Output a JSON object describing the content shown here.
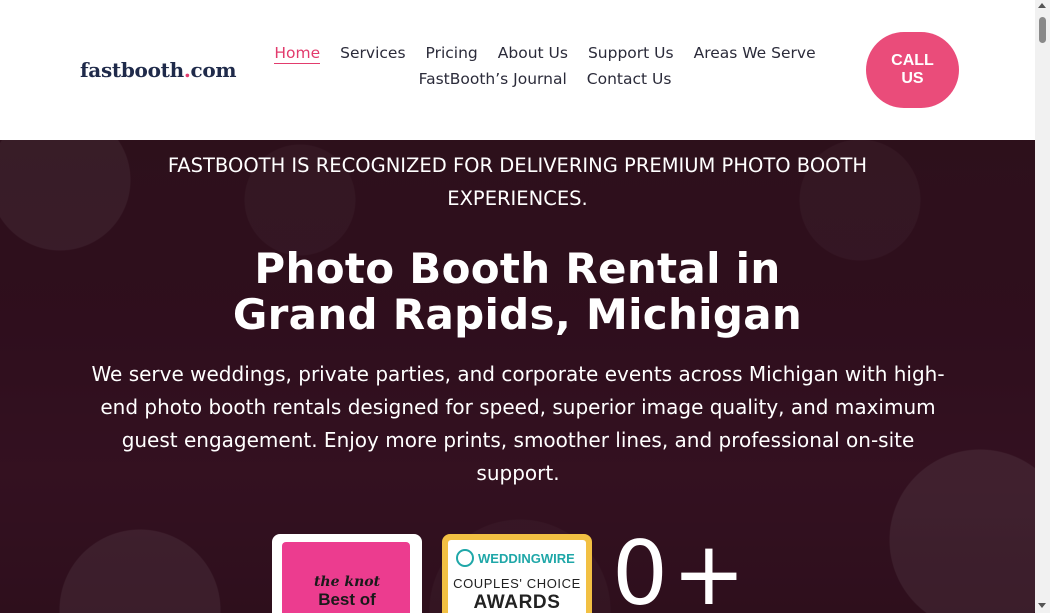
{
  "header": {
    "logo": {
      "prefix": "fastbooth",
      "dot": ".",
      "suffix": "com"
    },
    "nav": [
      {
        "label": "Home",
        "active": true
      },
      {
        "label": "Services"
      },
      {
        "label": "Pricing"
      },
      {
        "label": "About Us"
      },
      {
        "label": "Support Us"
      },
      {
        "label": "Areas We Serve"
      },
      {
        "label": "FastBooth’s Journal"
      },
      {
        "label": "Contact Us"
      }
    ],
    "call_button": "CALL US"
  },
  "hero": {
    "recognized": "FASTBOOTH IS RECOGNIZED FOR DELIVERING PREMIUM PHOTO BOOTH EXPERIENCES.",
    "headline_line1": "Photo Booth Rental in",
    "headline_line2": "Grand Rapids, Michigan",
    "description": "We serve weddings, private parties, and corporate events across Michigan with high-end photo booth rentals designed for speed, superior image quality, and maximum guest engagement. Enjoy more prints, smoother lines, and professional on-site support.",
    "badges": {
      "knot": {
        "line1": "the knot",
        "line2": "Best of"
      },
      "weddingwire": {
        "brand": "WEDDINGWIRE",
        "line1": "COUPLES' CHOICE",
        "line2": "AWARDS"
      }
    },
    "counter": "0+"
  },
  "colors": {
    "accent": "#ea4c7a",
    "nav_text": "#2b2b3a",
    "logo_text": "#1f2a4a",
    "hero_bg": "#3c1327"
  }
}
